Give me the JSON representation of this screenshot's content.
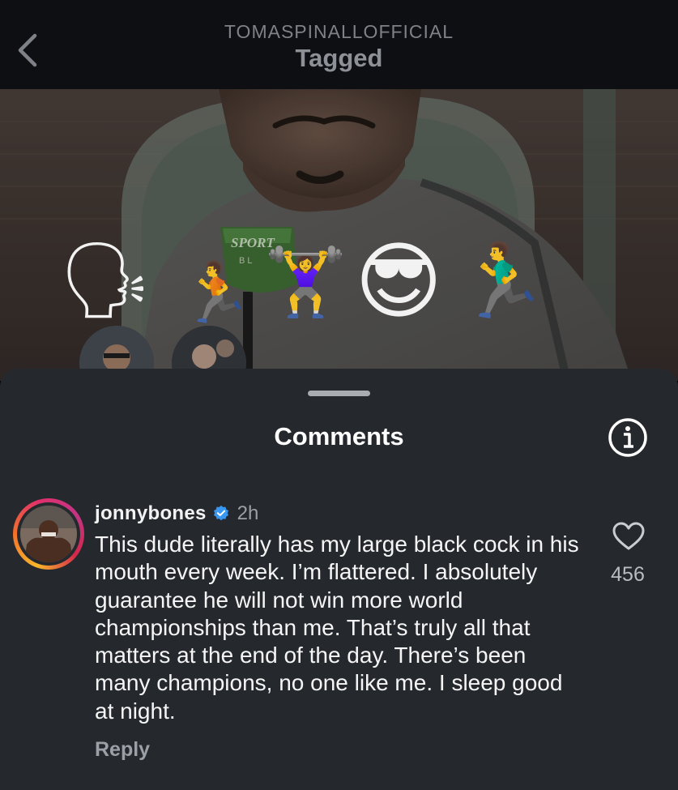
{
  "header": {
    "account": "TOMASPINALLOFFICIAL",
    "title": "Tagged",
    "back_icon": "chevron-left-icon"
  },
  "post": {
    "stickers": [
      "speaking-head-emoji",
      "man-running-emoji",
      "woman-lifting-weights-emoji",
      "smiling-face-with-sunglasses-emoji",
      "man-running-emoji"
    ],
    "sticker_glyphs": {
      "speaker": "🗣",
      "runner1": "🏃",
      "lifter": "🏋️‍♀️",
      "cool": "😎",
      "runner2": "🏃‍♂️"
    },
    "mic_text": "SPORT",
    "mic_subtext": "BL"
  },
  "sheet": {
    "title": "Comments",
    "info_icon": "info-circle-icon"
  },
  "comment": {
    "username": "jonnybones",
    "verified": true,
    "time": "2h",
    "text": "This dude literally has my large black cock in his mouth every week. I’m flattered. I absolutely guarantee he will not win more world championships than me. That’s truly all that matters at the end of the day. There’s been many champions, no one like me. I sleep good at night.",
    "likes": "456",
    "reply_label": "Reply"
  },
  "colors": {
    "sheet_bg": "#25292e",
    "verified_blue": "#3897f0",
    "muted_text": "#9aa0a6"
  }
}
